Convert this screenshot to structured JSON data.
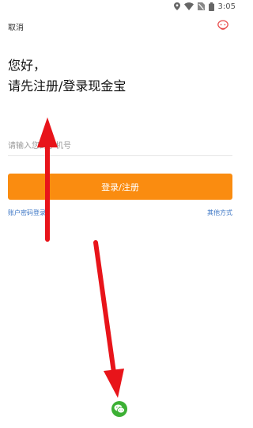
{
  "status_bar": {
    "time": "3:05",
    "icons": [
      "location-icon",
      "wifi-icon",
      "no-sim-icon",
      "battery-icon"
    ]
  },
  "header": {
    "cancel_label": "取消",
    "service_icon": "customer-service-icon"
  },
  "greeting": {
    "line1": "您好，",
    "line2": "请先注册/登录现金宝"
  },
  "form": {
    "phone_placeholder": "请输入您的手机号",
    "login_button": "登录/注册",
    "left_link": "账户密码登录",
    "right_link": "其他方式"
  },
  "third_party": {
    "wechat_icon": "wechat-icon"
  },
  "colors": {
    "accent": "#fa8c10",
    "link": "#3a74c4",
    "wechat": "#3cb034",
    "annotation_arrow": "#e8141a"
  }
}
